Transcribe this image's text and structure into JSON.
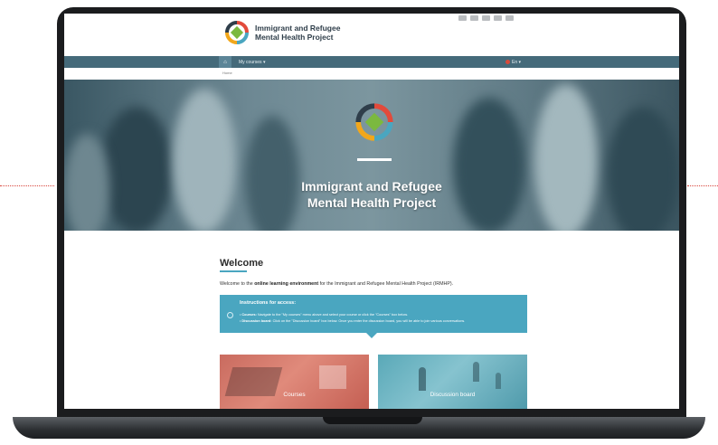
{
  "header": {
    "logo_line1": "Immigrant and Refugee",
    "logo_line2": "Mental Health Project"
  },
  "navbar": {
    "home_icon": "home-icon",
    "courses_menu": "My courses ▾",
    "language": "En ▾"
  },
  "breadcrumb": {
    "home": "Home"
  },
  "hero": {
    "title_line1": "Immigrant and Refugee",
    "title_line2": "Mental Health Project"
  },
  "welcome": {
    "title": "Welcome",
    "intro_before": "Welcome to the ",
    "intro_bold": "online learning environment",
    "intro_after": " for the Immigrant and Refugee Mental Health Project (IRMHP)."
  },
  "instructions": {
    "title": "Instructions for access:",
    "items": [
      {
        "label": "Courses:",
        "text": " Navigate to the \"My courses\" menu above and select your course or click the \"Courses\" box below."
      },
      {
        "label": "Discussion board:",
        "text": " Click on the \"Discussion board\" box below. Once you enter the discussion board, you will be able to join various conversations."
      }
    ]
  },
  "cards": {
    "courses": "Courses",
    "board": "Discussion board"
  },
  "colors": {
    "accent": "#4aa6c0",
    "nav": "#456a7a",
    "courses_card": "#d87668",
    "board_card": "#6fb6c4"
  }
}
